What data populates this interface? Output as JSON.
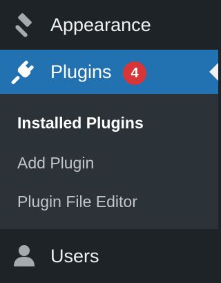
{
  "sidebar": {
    "appearance": {
      "label": "Appearance",
      "icon": "paintbrush-icon"
    },
    "plugins": {
      "label": "Plugins",
      "icon": "plugin-icon",
      "badge": "4",
      "submenu": [
        {
          "label": "Installed Plugins",
          "current": true
        },
        {
          "label": "Add Plugin",
          "current": false
        },
        {
          "label": "Plugin File Editor",
          "current": false
        }
      ]
    },
    "users": {
      "label": "Users",
      "icon": "user-icon"
    }
  },
  "colors": {
    "sidebar_bg": "#1d2327",
    "submenu_bg": "#2c3338",
    "active_bg": "#2271b1",
    "badge_bg": "#d63638",
    "text": "#f0f0f1",
    "submenu_text": "#c3c4c7"
  }
}
